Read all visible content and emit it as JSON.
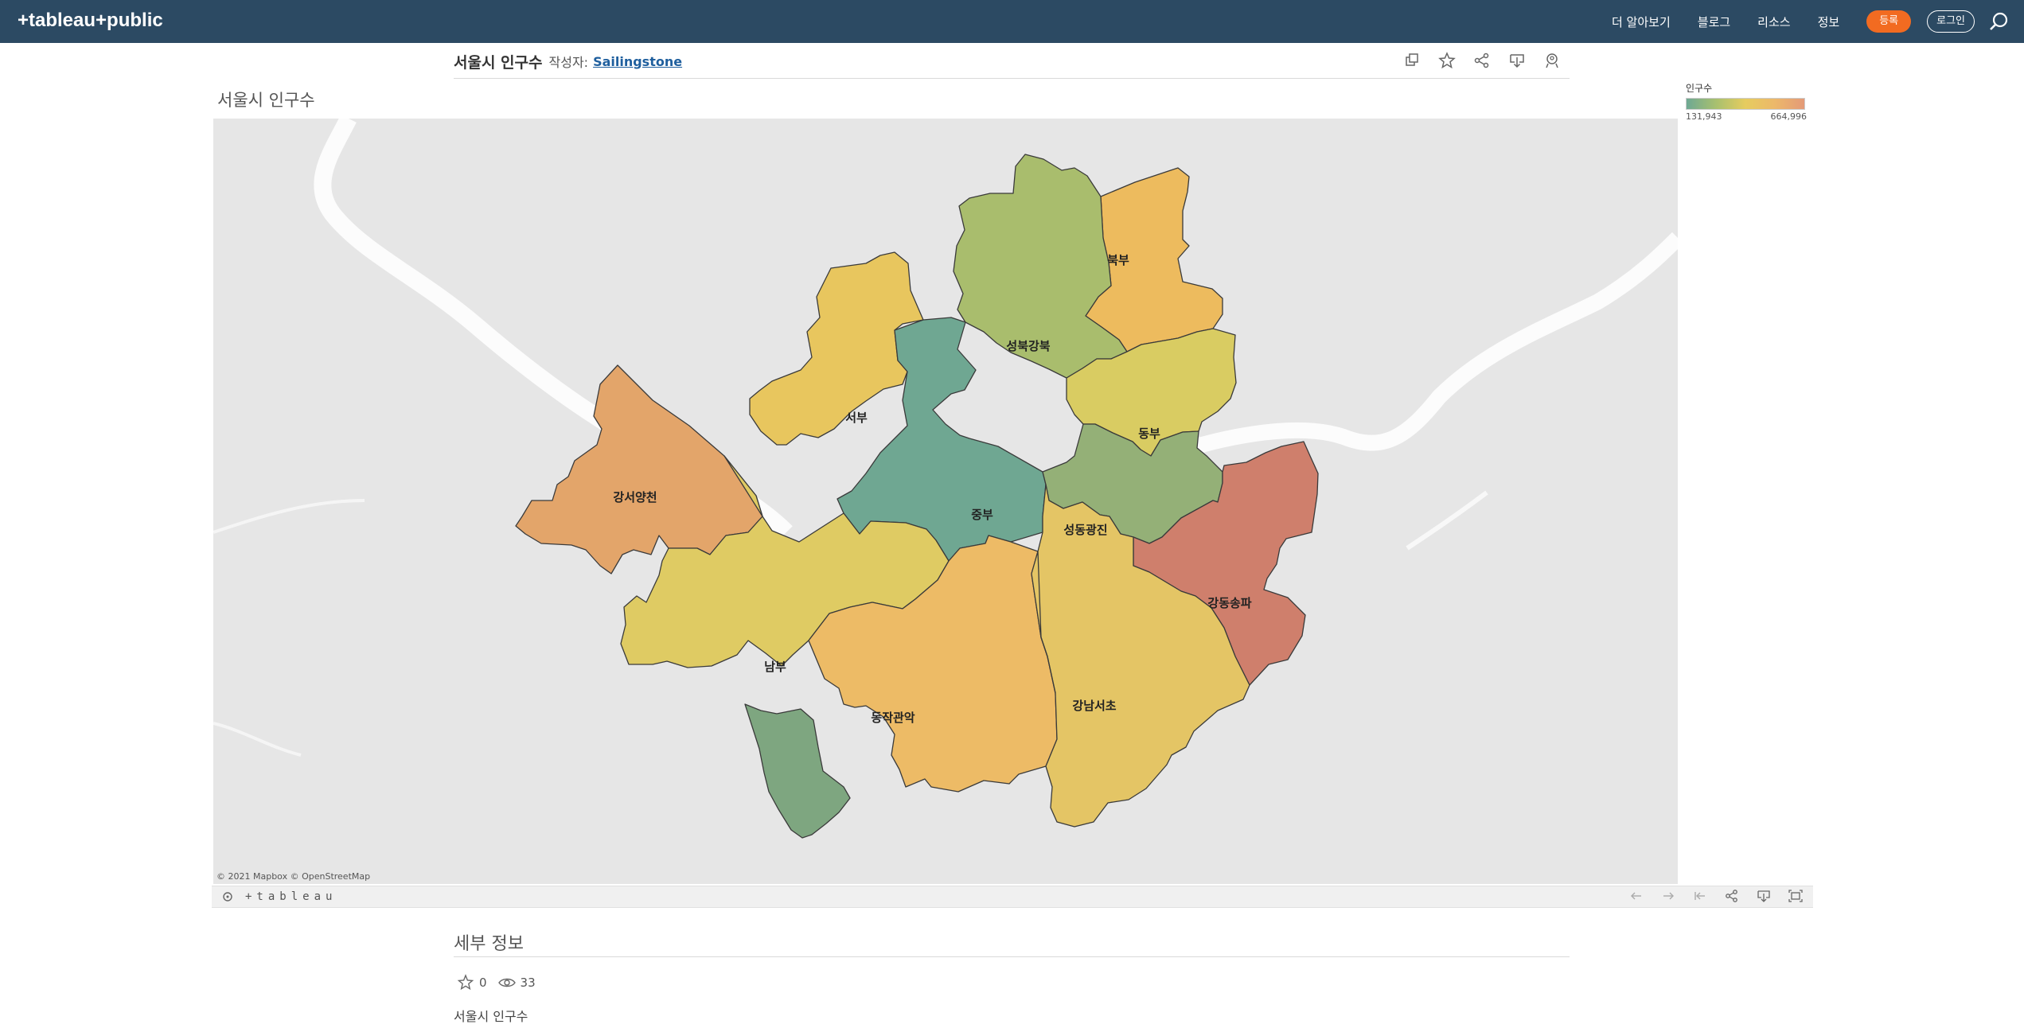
{
  "header": {
    "logo_text": "+tableau+public",
    "nav_items": [
      "더 알아보기",
      "블로그",
      "리소스",
      "정보"
    ],
    "signup_label": "등록",
    "login_label": "로그인"
  },
  "viz": {
    "title": "서울시 인구수",
    "byline": "작성자:",
    "author": "Sailingstone"
  },
  "dashboard": {
    "title": "서울시 인구수",
    "attribution": "© 2021 Mapbox  © OpenStreetMap"
  },
  "legend": {
    "title": "인구수",
    "min": "131,943",
    "max": "664,996"
  },
  "toolbar": {
    "logo_text": "+tableau"
  },
  "details": {
    "heading": "세부 정보",
    "favorites": "0",
    "views": "33",
    "description": "서울시 인구수"
  },
  "regions": [
    {
      "name": "북부",
      "color": "#edbb5e"
    },
    {
      "name": "성북강북",
      "color": "#a9bd6d"
    },
    {
      "name": "서부",
      "color": "#e8c65e"
    },
    {
      "name": "동부",
      "color": "#d9cc62"
    },
    {
      "name": "강서양천",
      "color": "#e3a56a"
    },
    {
      "name": "중부",
      "color": "#6fa792"
    },
    {
      "name": "성동광진",
      "color": "#94b077"
    },
    {
      "name": "강동송파",
      "color": "#cf7f6c"
    },
    {
      "name": "남부",
      "color": "#dfcb63"
    },
    {
      "name": "동작관악",
      "color": "#edbb66"
    },
    {
      "name": "강남서초",
      "color": "#e4c565"
    }
  ]
}
